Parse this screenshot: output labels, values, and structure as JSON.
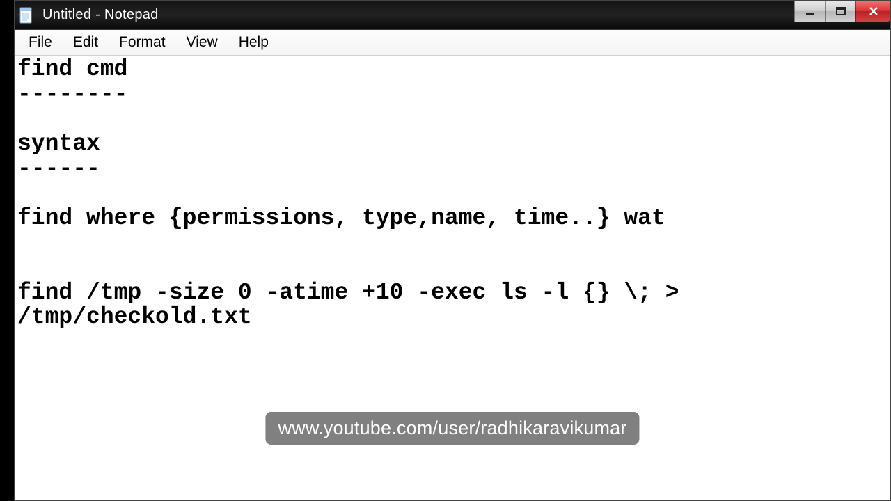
{
  "window": {
    "title": "Untitled - Notepad"
  },
  "menu": {
    "file": "File",
    "edit": "Edit",
    "format": "Format",
    "view": "View",
    "help": "Help"
  },
  "editor": {
    "content": "find cmd\n--------\n\nsyntax\n------\n\nfind where {permissions, type,name, time..} wat\n\n\nfind /tmp -size 0 -atime +10 -exec ls -l {} \\; > /tmp/checkold.txt"
  },
  "overlay": {
    "text": "www.youtube.com/user/radhikaravikumar"
  }
}
